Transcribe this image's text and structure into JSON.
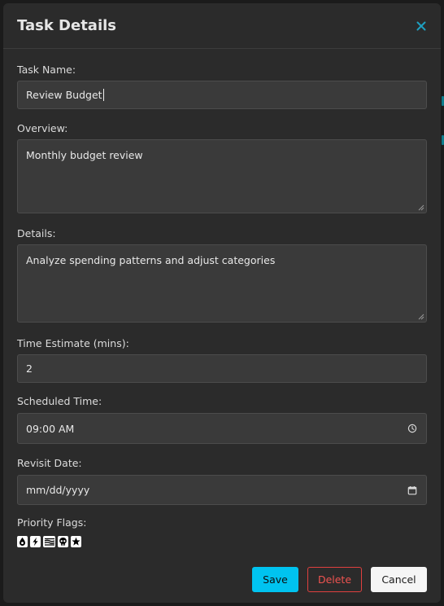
{
  "modal": {
    "title": "Task Details"
  },
  "fields": {
    "task_name": {
      "label": "Task Name:",
      "value": "Review Budget"
    },
    "overview": {
      "label": "Overview:",
      "value": "Monthly budget review"
    },
    "details": {
      "label": "Details:",
      "value": "Analyze spending patterns and adjust categories"
    },
    "time_estimate": {
      "label": "Time Estimate (mins):",
      "value": "2"
    },
    "scheduled_time": {
      "label": "Scheduled Time:",
      "value": "09:00 AM",
      "icon": "clock-icon"
    },
    "revisit_date": {
      "label": "Revisit Date:",
      "placeholder": "mm/dd/yyyy",
      "icon": "calendar-icon"
    }
  },
  "priority_flags": {
    "label": "Priority Flags:",
    "icons": [
      "drop-icon",
      "lightning-icon",
      "waves-icon",
      "skull-icon",
      "star-icon"
    ]
  },
  "actions": {
    "save_label": "Save",
    "delete_label": "Delete",
    "cancel_label": "Cancel"
  },
  "colors": {
    "accent": "#00c3f0",
    "danger": "#ef5350",
    "close": "#1e9fc0",
    "surface": "#2b2b2b",
    "input_bg": "#3a3a3a"
  }
}
